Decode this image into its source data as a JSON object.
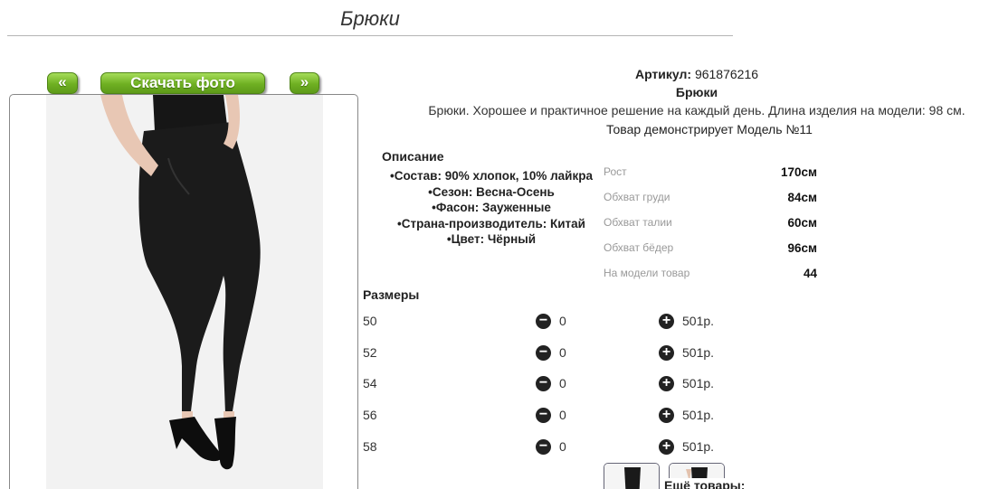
{
  "page": {
    "title": "Брюки"
  },
  "gallery": {
    "prev_label": "«",
    "download_label": "Скачать фото",
    "next_label": "»"
  },
  "product": {
    "article_label": "Артикул:",
    "article_value": "961876216",
    "name": "Брюки",
    "description": "Брюки. Хорошее и практичное решение на каждый день. Длина изделия на модели: 98 см.",
    "model_note": "Товар демонстрирует Модель №11"
  },
  "details": {
    "heading": "Описание",
    "items": [
      "Состав: 90% хлопок, 10% лайкра",
      "Сезон: Весна-Осень",
      "Фасон: Зауженные",
      "Страна-производитель: Китай",
      "Цвет: Чёрный"
    ]
  },
  "specs": [
    {
      "label": "Рост",
      "value": "170см"
    },
    {
      "label": "Обхват груди",
      "value": "84см"
    },
    {
      "label": "Обхват талии",
      "value": "60см"
    },
    {
      "label": "Обхват бёдер",
      "value": "96см"
    },
    {
      "label": "На модели товар",
      "value": "44"
    }
  ],
  "sizes": {
    "heading": "Размеры",
    "rows": [
      {
        "size": "50",
        "qty": "0",
        "price": "501р."
      },
      {
        "size": "52",
        "qty": "0",
        "price": "501р."
      },
      {
        "size": "54",
        "qty": "0",
        "price": "501р."
      },
      {
        "size": "56",
        "qty": "0",
        "price": "501р."
      },
      {
        "size": "58",
        "qty": "0",
        "price": "501р."
      }
    ]
  },
  "more": {
    "label": "Ещё товары:"
  },
  "icons": {
    "minus": "minus-circle-icon",
    "plus": "plus-circle-icon",
    "accent": "#6fb022"
  }
}
